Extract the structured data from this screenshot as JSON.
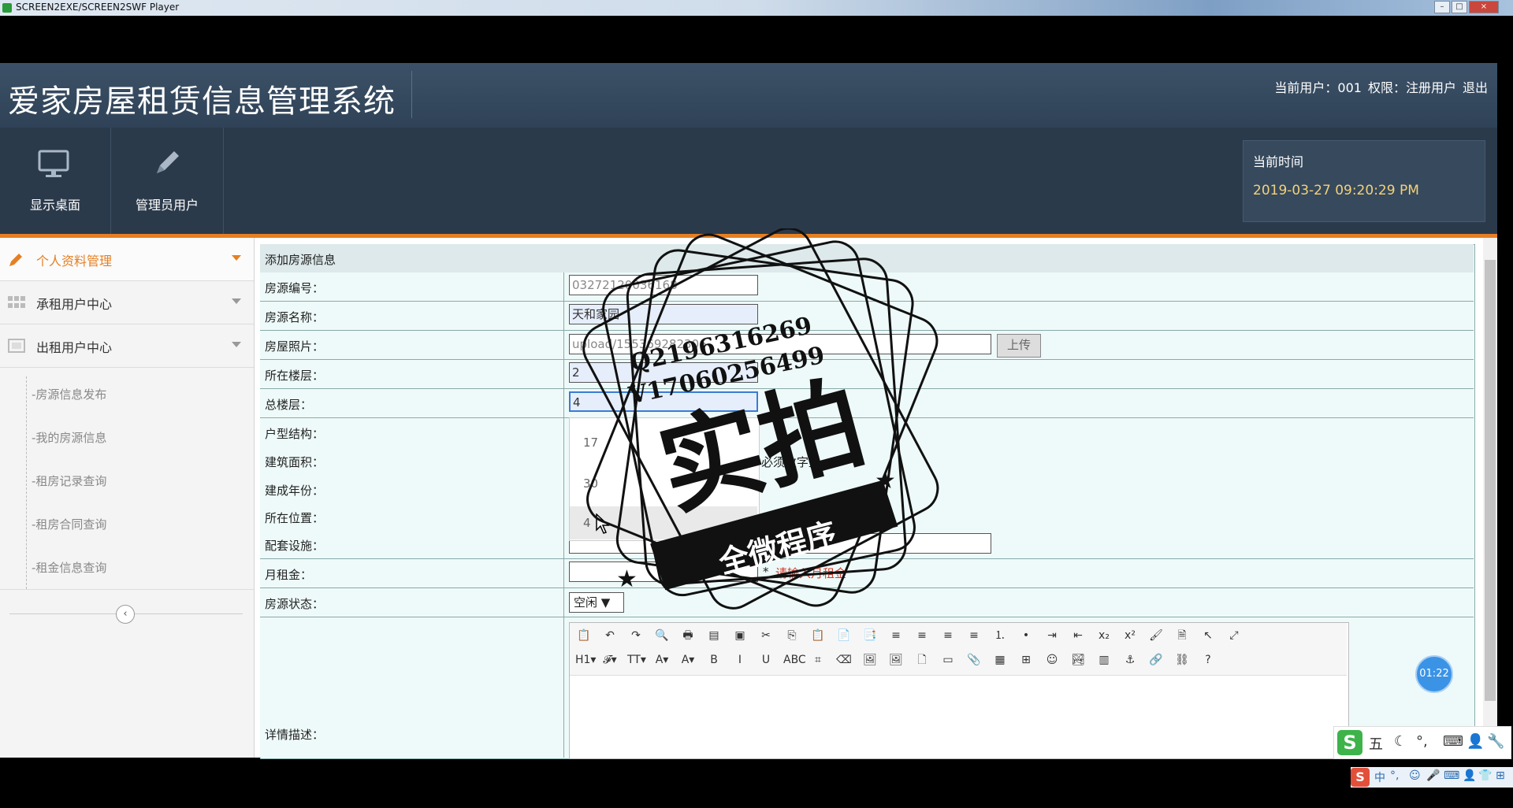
{
  "os": {
    "title": "SCREEN2EXE/SCREEN2SWF Player",
    "min": "–",
    "max": "□",
    "close": "×"
  },
  "app": {
    "title": "爱家房屋租赁信息管理系统"
  },
  "user": {
    "current": "当前用户：001",
    "role": "权限：注册用户",
    "logout": "退出"
  },
  "toolbar": {
    "desktop": "显示桌面",
    "admin": "管理员用户"
  },
  "time": {
    "label": "当前时间",
    "value": "2019-03-27 09:20:29 PM"
  },
  "sidebar": {
    "items": [
      {
        "label": "个人资料管理"
      },
      {
        "label": "承租用户中心"
      },
      {
        "label": "出租用户中心"
      }
    ],
    "subitems": [
      "-房源信息发布",
      "-我的房源信息",
      "-租房记录查询",
      "-租房合同查询",
      "-租金信息查询"
    ],
    "collapse": "‹"
  },
  "form": {
    "title": "添加房源信息",
    "labels": [
      "房源编号：",
      "房源名称：",
      "房屋照片：",
      "所在楼层：",
      "总楼层：",
      "户型结构：",
      "建筑面积：",
      "建成年份：",
      "所在位置：",
      "配套设施：",
      "月租金：",
      "房源状态：",
      "详情描述："
    ],
    "values": {
      "code": "03272120036168",
      "name": "天和家园",
      "photo": "upload/155369282306",
      "floor": "2",
      "total": "4",
      "rent": "",
      "status": "空闲 ▼"
    },
    "upload": "上传",
    "area_hint": "必须数字型",
    "rent_hint_star": "*",
    "rent_hint": "请输入月租金",
    "autocomplete": [
      "17",
      "30",
      "4"
    ]
  },
  "editor": {
    "row1": [
      "📋",
      "↶",
      "↷",
      "🔍",
      "🖶",
      "▤",
      "▣",
      "✂",
      "⎘",
      "📋",
      "📄",
      "📑",
      "≡",
      "≡",
      "≡",
      "≡",
      "⒈",
      "•",
      "⇥",
      "⇤",
      "x₂",
      "x²",
      "🖌",
      "🗎",
      "↖",
      "⤢"
    ],
    "row2": [
      "H1▾",
      "𝓕▾",
      "TT▾",
      "A▾",
      "A▾",
      "B",
      "I",
      "U",
      "ABC",
      "⌗",
      "⌫",
      "🖼",
      "🖼",
      "🗋",
      "▭",
      "📎",
      "▦",
      "⊞",
      "☺",
      "🏞",
      "▥",
      "⚓",
      "🔗",
      "⛓",
      "?"
    ]
  },
  "timer": "01:22",
  "stamp": {
    "qq": "Q2196316269",
    "wx": "V17060256499",
    "main": "实拍",
    "sub": "全微程序"
  },
  "ime": {
    "bar1": [
      "五",
      "☾",
      "°,",
      "⌨",
      "👤",
      "🔧"
    ],
    "bar2": [
      "中",
      "°,",
      "☺",
      "🎤",
      "⌨",
      "👤",
      "👕",
      "⊞"
    ]
  },
  "colors": {
    "accent": "#e67f22",
    "header": "#2f4257",
    "time": "#f3d27a"
  }
}
